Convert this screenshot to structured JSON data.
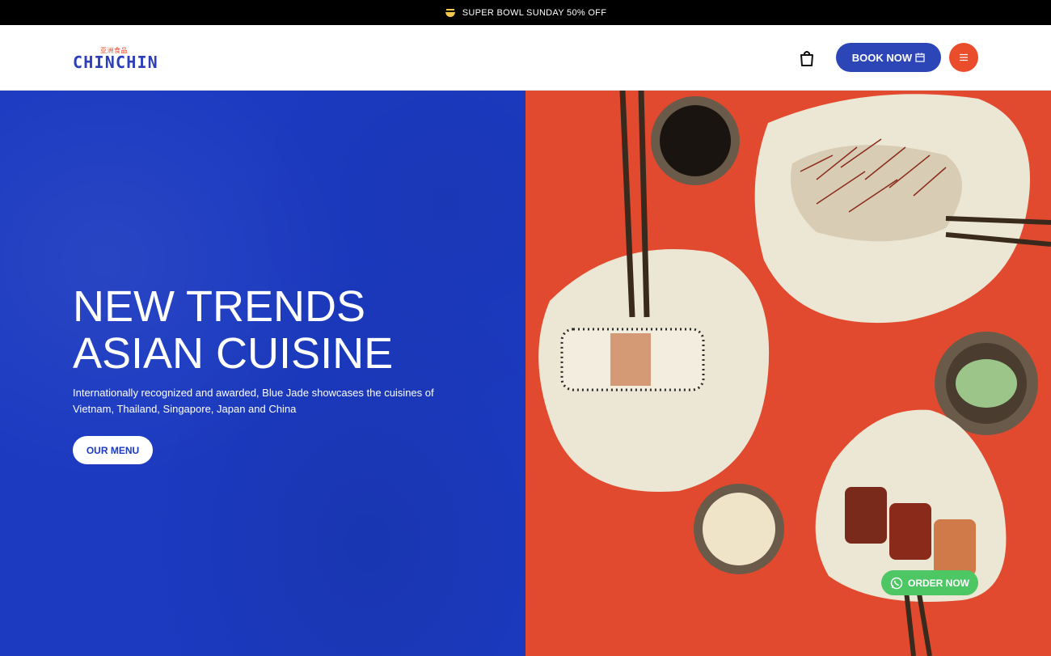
{
  "announcement": {
    "text": "SUPER BOWL SUNDAY 50% OFF",
    "icon": "bowl-icon"
  },
  "header": {
    "logo_text": "CHINCHIN",
    "logo_subtext": "亚洲食品",
    "cart_icon": "shopping-bag-icon",
    "book_label": "BOOK NOW",
    "book_icon": "calendar-icon",
    "menu_icon": "hamburger-icon"
  },
  "hero": {
    "title_line1": "NEW TRENDS",
    "title_line2": "ASIAN CUISINE",
    "description": "Internationally recognized and awarded, Blue Jade showcases the cuisines of Vietnam, Thailand, Singapore, Japan and China",
    "cta_label": "OUR MENU"
  },
  "order": {
    "label": "ORDER NOW",
    "icon": "whatsapp-icon"
  },
  "colors": {
    "brand_blue": "#1b3ac0",
    "button_blue": "#2c46b8",
    "accent_orange": "#ea4d2c",
    "hero_red": "#e14a2f",
    "whatsapp_green": "#4cc764"
  }
}
